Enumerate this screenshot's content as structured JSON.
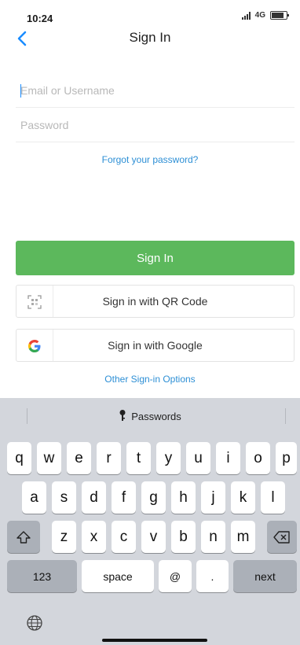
{
  "status": {
    "time": "10:24",
    "network": "4G"
  },
  "nav": {
    "title": "Sign In"
  },
  "form": {
    "email_placeholder": "Email or Username",
    "password_placeholder": "Password",
    "forgot_link": "Forgot your password?"
  },
  "actions": {
    "sign_in": "Sign In",
    "qr_sign_in": "Sign in with QR Code",
    "google_sign_in": "Sign in with Google",
    "other_options": "Other Sign-in Options"
  },
  "keyboard": {
    "passwords_label": "Passwords",
    "row1": [
      "q",
      "w",
      "e",
      "r",
      "t",
      "y",
      "u",
      "i",
      "o",
      "p"
    ],
    "row2": [
      "a",
      "s",
      "d",
      "f",
      "g",
      "h",
      "j",
      "k",
      "l"
    ],
    "row3": [
      "z",
      "x",
      "c",
      "v",
      "b",
      "n",
      "m"
    ],
    "numbers_key": "123",
    "space_key": "space",
    "at_key": "@",
    "dot_key": ".",
    "next_key": "next"
  },
  "colors": {
    "primary": "#5cb85c",
    "link": "#2d8fd5",
    "back": "#1a8cff"
  }
}
